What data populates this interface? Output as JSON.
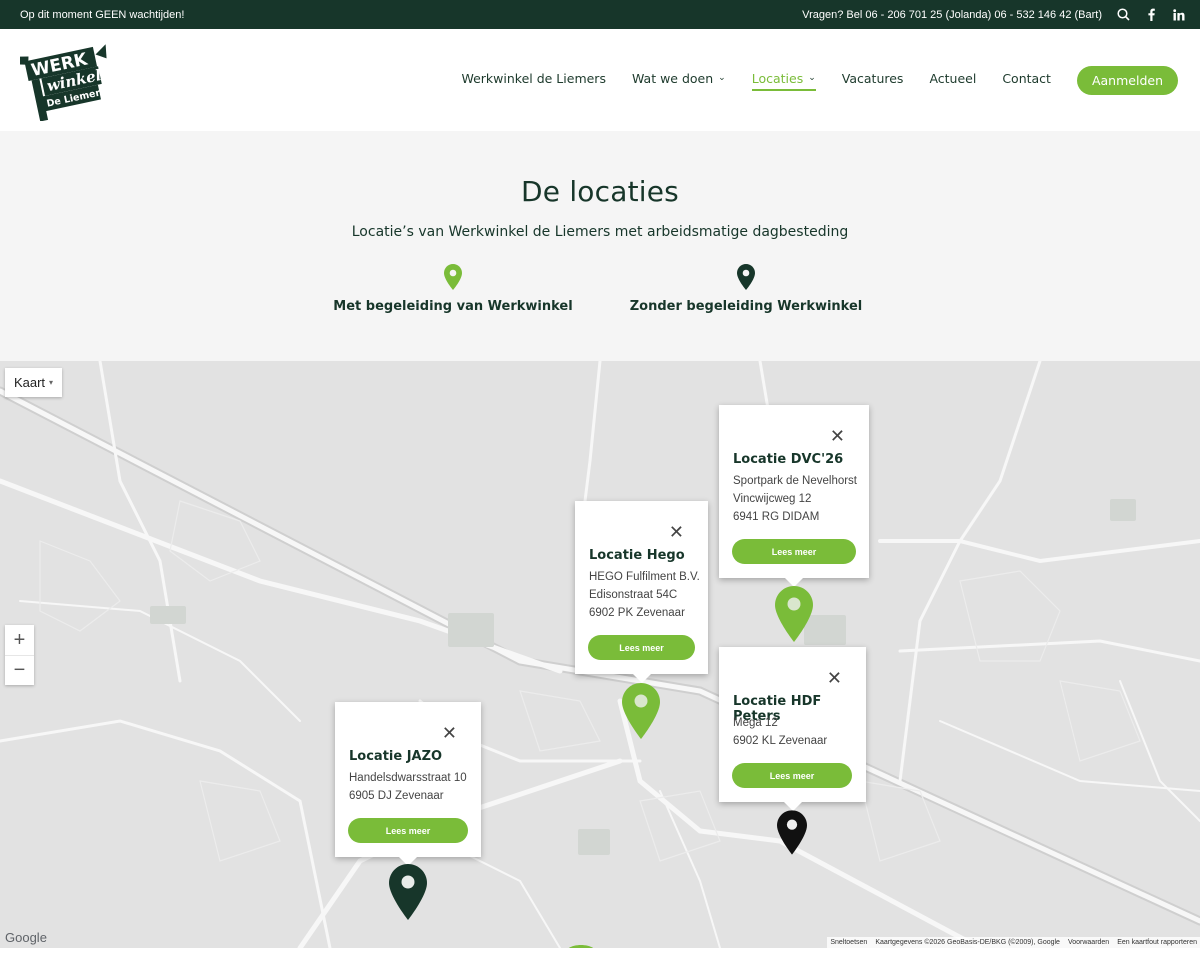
{
  "topbar": {
    "notice": "Op dit moment GEEN wachtijden!",
    "contact": "Vragen? Bel 06 - 206 701 25 (Jolanda) 06 - 532 146 42 (Bart)",
    "icons": [
      "search-icon",
      "facebook-icon",
      "linkedin-icon"
    ]
  },
  "logo": {
    "line1": "WERK",
    "line2": "winkel",
    "line3": "De Liemers"
  },
  "nav": {
    "items": [
      {
        "label": "Werkwinkel de Liemers"
      },
      {
        "label": "Wat we doen"
      },
      {
        "label": "Locaties"
      },
      {
        "label": "Vacatures"
      },
      {
        "label": "Actueel"
      },
      {
        "label": "Contact"
      }
    ],
    "cta": "Aanmelden"
  },
  "hero": {
    "title": "De locaties",
    "subtitle": "Locatie’s van Werkwinkel de Liemers met arbeidsmatige dagbesteding",
    "legend": [
      {
        "label": "Met begeleiding van Werkwinkel",
        "color": "#7abc39"
      },
      {
        "label": "Zonder begeleiding Werkwinkel",
        "color": "#17362a"
      }
    ]
  },
  "map": {
    "type_control": "Kaart",
    "zoom_in": "+",
    "zoom_out": "−",
    "brand": "Google",
    "attribution": [
      "Sneltoetsen",
      "Kaartgegevens ©2026 GeoBasis-DE/BKG (©2009), Google",
      "Voorwaarden",
      "Een kaartfout rapporteren"
    ],
    "popups": [
      {
        "title": "Locatie DVC'26",
        "lines": [
          "Sportpark de Nevelhorst",
          "Vincwijcweg 12",
          "6941 RG DIDAM"
        ],
        "button": "Lees meer"
      },
      {
        "title": "Locatie Hego",
        "lines": [
          "HEGO Fulfilment B.V.",
          "Edisonstraat 54C",
          "6902 PK Zevenaar"
        ],
        "button": "Lees meer"
      },
      {
        "title": "Locatie HDF Peters",
        "lines": [
          "Mega 12",
          "6902 KL Zevenaar"
        ],
        "button": "Lees meer"
      },
      {
        "title": "Locatie JAZO",
        "lines": [
          "Handelsdwarsstraat 10",
          "6905 DJ Zevenaar"
        ],
        "button": "Lees meer"
      }
    ],
    "pin_colors": {
      "green": "#7abc39",
      "dark": "#17362a",
      "black": "#111111"
    }
  }
}
